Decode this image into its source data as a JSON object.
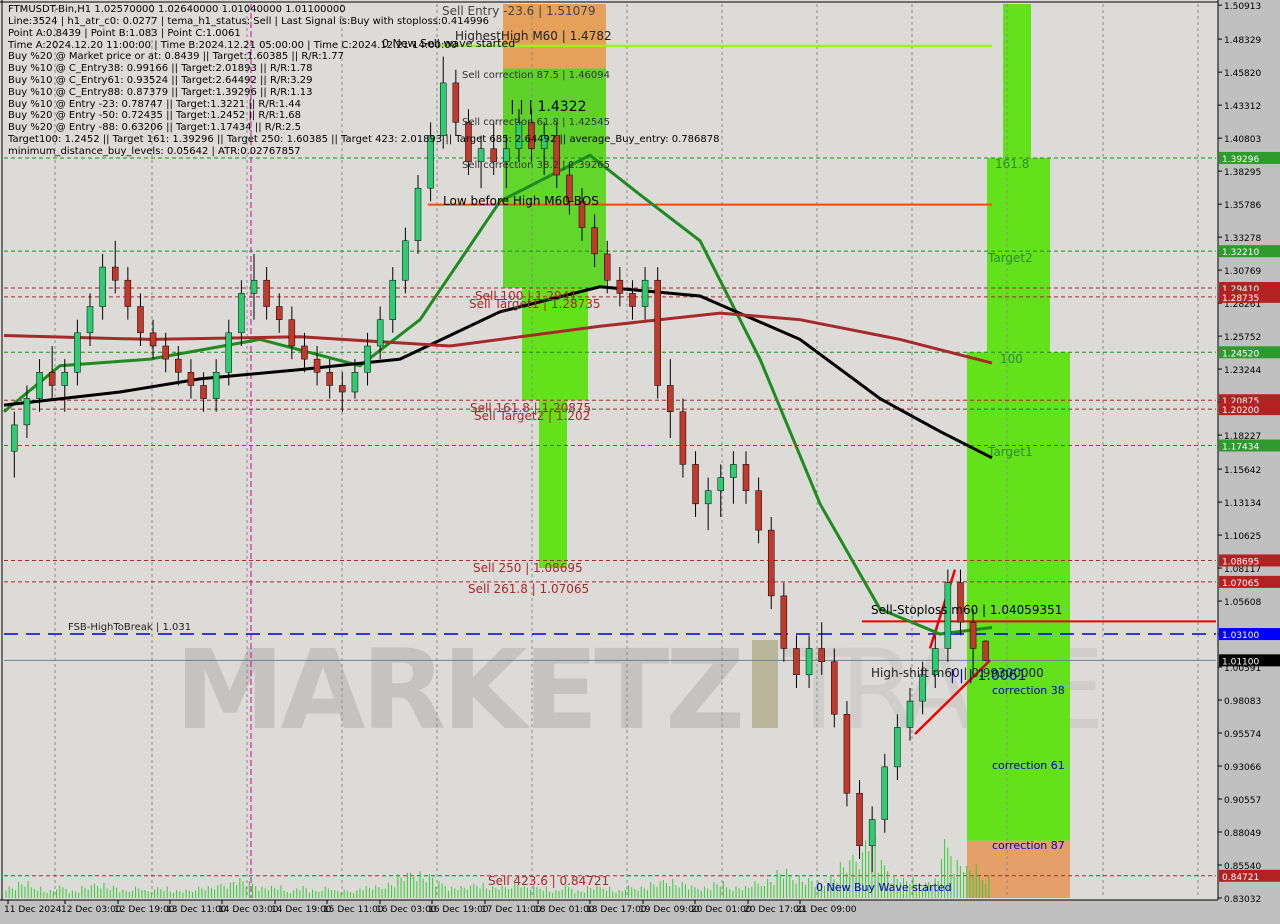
{
  "window": {
    "symbol_header": "FTMUSDT-Bin,H1  1.02570000 1.02640000 1.01040000 1.01100000"
  },
  "info_panel": [
    "Line:3524 | h1_atr_c0: 0.0277 | tema_h1_status: Sell | Last Signal is:Buy with stoploss:0.414996",
    "Point A:0.8439 | Point B:1.083 | Point C:1.0061",
    "Time A:2024.12.20 11:00:00 | Time B:2024.12.21 05:00:00 | Time C:2024.12.21 14:00:00",
    "Buy %20 @ Market price or at: 0.8439 || Target:1.60385 || R/R:1.77",
    "Buy %10 @ C_Entry38: 0.99166 || Target:2.01893 || R/R:1.78",
    "Buy %10 @ C_Entry61: 0.93524 || Target:2.64492 || R/R:3.29",
    "Buy %10 @ C_Entry88: 0.87379 || Target:1.39296 || R/R:1.13",
    "Buy %10 @ Entry -23: 0.78747 || Target:1.3221 || R/R:1.44",
    "Buy %20 @ Entry -50: 0.72435 || Target:1.2452 || R/R:1.68",
    "Buy %20 @ Entry -88: 0.63206 || Target:1.17434 || R/R:2.5",
    "Target100: 1.2452 || Target 161: 1.39296 || Target 250: 1.60385 || Target 423: 2.01893 || Target 685: 2.64492 || average_Buy_entry: 0.786878",
    "minimum_distance_buy_levels: 0.05642 | ATR:0.02767857"
  ],
  "watermark": {
    "text1": "MARKETZ",
    "text2": "I",
    "text3": "TRADE"
  },
  "chart_data": {
    "type": "candlestick",
    "title": "FTMUSDT-Bin,H1",
    "ohlc_last": {
      "open": 1.0257,
      "high": 1.0264,
      "low": 1.0104,
      "close": 1.011
    },
    "ylim": [
      0.83032,
      1.51
    ],
    "y_ticks": [
      "1.50913",
      "1.48329",
      "1.45820",
      "1.43312",
      "1.40803",
      "1.38295",
      "1.35786",
      "1.33278",
      "1.30769",
      "1.28261",
      "1.25752",
      "1.23244",
      "1.20735",
      "1.18227",
      "1.15642",
      "1.13134",
      "1.10625",
      "1.08117",
      "1.05608",
      "1.03100",
      "1.00591",
      "0.98083",
      "0.95574",
      "0.93066",
      "0.90557",
      "0.88049",
      "0.85540",
      "0.83032"
    ],
    "x_ticks": [
      "11 Dec 2024",
      "12 Dec 03:00",
      "12 Dec 19:00",
      "13 Dec 11:00",
      "14 Dec 03:00",
      "14 Dec 19:00",
      "15 Dec 11:00",
      "16 Dec 03:00",
      "16 Dec 19:00",
      "17 Dec 11:00",
      "18 Dec 01:00",
      "18 Dec 17:00",
      "19 Dec 09:00",
      "20 Dec 01:00",
      "20 Dec 17:00",
      "21 Dec 09:00"
    ],
    "price_badges": [
      {
        "value": "1.39296",
        "color": "#2e9b2e"
      },
      {
        "value": "1.32210",
        "color": "#2e9b2e"
      },
      {
        "value": "1.29410",
        "color": "#b22222"
      },
      {
        "value": "1.28735",
        "color": "#b22222"
      },
      {
        "value": "1.24520",
        "color": "#2e9b2e"
      },
      {
        "value": "1.20875",
        "color": "#b22222"
      },
      {
        "value": "1.20200",
        "color": "#b22222"
      },
      {
        "value": "1.17434",
        "color": "#2e9b2e"
      },
      {
        "value": "1.08695",
        "color": "#b22222"
      },
      {
        "value": "1.07065",
        "color": "#b22222"
      },
      {
        "value": "1.03100",
        "color": "#0000ff"
      },
      {
        "value": "1.01100",
        "color": "#000000"
      },
      {
        "value": "0.84721",
        "color": "#b22222"
      }
    ],
    "sell_levels": [
      {
        "label": "Sell Entry -23.6 | 1.51079",
        "value": 1.51079
      },
      {
        "label": "HighestHigh   M60 | 1.4782",
        "value": 1.4782
      },
      {
        "label": "Sell correction 87.5 | 1.46094",
        "value": 1.46094
      },
      {
        "label": "| | | 1.4322",
        "value": 1.4322
      },
      {
        "label": "Sell correction 61.8 | 1.42545",
        "value": 1.42545
      },
      {
        "label": "Sell correction 38.2 | 1.39265",
        "value": 1.39265
      },
      {
        "label": "Low before High   M60-BOS",
        "value": 1.3575
      },
      {
        "label": "Sell 100 | 1.2941",
        "value": 1.2941
      },
      {
        "label": "Sell Target1 | 1.28735",
        "value": 1.28735
      },
      {
        "label": "Sell 161.8 | 1.20875",
        "value": 1.20875
      },
      {
        "label": "Sell Target2 | 1.202",
        "value": 1.202
      },
      {
        "label": "Sell 250 | 1.08695",
        "value": 1.08695
      },
      {
        "label": "Sell 261.8 | 1.07065",
        "value": 1.07065
      },
      {
        "label": "Sell 423.6 | 0.84721",
        "value": 0.84721
      }
    ],
    "buy_levels": [
      {
        "label": "161.8",
        "value": 1.39296
      },
      {
        "label": "Target2",
        "value": 1.3221
      },
      {
        "label": "100",
        "value": 1.2452
      },
      {
        "label": "Target1",
        "value": 1.17434
      },
      {
        "label": "correction 38",
        "value": 0.99166
      },
      {
        "label": "correction 61",
        "value": 0.93524
      },
      {
        "label": "correction 87",
        "value": 0.87379
      }
    ],
    "annotations": {
      "new_sell_wave": "0 New Sell wave started",
      "new_buy_wave": "0 New Buy Wave started",
      "fsb_high": "FSB-HighToBreak | 1.031",
      "sell_stoploss": "Sell-Stoploss m60 | 1.04059351",
      "high_shift": "High-shift m60 | 0.99300000",
      "point_c_label": "| | | 1.0061"
    },
    "moving_averages": [
      {
        "name": "green",
        "color": "#1e8c1e"
      },
      {
        "name": "black",
        "color": "#000000"
      },
      {
        "name": "brown",
        "color": "#a52a2a"
      }
    ],
    "candles": [
      [
        1.17,
        1.2,
        1.15,
        1.19
      ],
      [
        1.19,
        1.22,
        1.18,
        1.21
      ],
      [
        1.21,
        1.24,
        1.2,
        1.23
      ],
      [
        1.23,
        1.25,
        1.21,
        1.22
      ],
      [
        1.22,
        1.24,
        1.2,
        1.23
      ],
      [
        1.23,
        1.27,
        1.22,
        1.26
      ],
      [
        1.26,
        1.29,
        1.25,
        1.28
      ],
      [
        1.28,
        1.32,
        1.27,
        1.31
      ],
      [
        1.31,
        1.33,
        1.29,
        1.3
      ],
      [
        1.3,
        1.31,
        1.27,
        1.28
      ],
      [
        1.28,
        1.29,
        1.25,
        1.26
      ],
      [
        1.26,
        1.27,
        1.24,
        1.25
      ],
      [
        1.25,
        1.26,
        1.23,
        1.24
      ],
      [
        1.24,
        1.25,
        1.22,
        1.23
      ],
      [
        1.23,
        1.24,
        1.21,
        1.22
      ],
      [
        1.22,
        1.23,
        1.2,
        1.21
      ],
      [
        1.21,
        1.24,
        1.2,
        1.23
      ],
      [
        1.23,
        1.27,
        1.22,
        1.26
      ],
      [
        1.26,
        1.3,
        1.25,
        1.29
      ],
      [
        1.29,
        1.32,
        1.27,
        1.3
      ],
      [
        1.3,
        1.31,
        1.27,
        1.28
      ],
      [
        1.28,
        1.29,
        1.26,
        1.27
      ],
      [
        1.27,
        1.28,
        1.24,
        1.25
      ],
      [
        1.25,
        1.26,
        1.23,
        1.24
      ],
      [
        1.24,
        1.25,
        1.22,
        1.23
      ],
      [
        1.23,
        1.24,
        1.21,
        1.22
      ],
      [
        1.22,
        1.23,
        1.2,
        1.215
      ],
      [
        1.215,
        1.24,
        1.21,
        1.23
      ],
      [
        1.23,
        1.26,
        1.22,
        1.25
      ],
      [
        1.25,
        1.28,
        1.24,
        1.27
      ],
      [
        1.27,
        1.31,
        1.26,
        1.3
      ],
      [
        1.3,
        1.34,
        1.29,
        1.33
      ],
      [
        1.33,
        1.38,
        1.32,
        1.37
      ],
      [
        1.37,
        1.42,
        1.36,
        1.41
      ],
      [
        1.41,
        1.47,
        1.4,
        1.45
      ],
      [
        1.45,
        1.46,
        1.41,
        1.42
      ],
      [
        1.42,
        1.43,
        1.38,
        1.39
      ],
      [
        1.39,
        1.41,
        1.37,
        1.4
      ],
      [
        1.4,
        1.42,
        1.38,
        1.39
      ],
      [
        1.39,
        1.41,
        1.37,
        1.4
      ],
      [
        1.4,
        1.43,
        1.39,
        1.42
      ],
      [
        1.42,
        1.43,
        1.39,
        1.4
      ],
      [
        1.4,
        1.42,
        1.38,
        1.41
      ],
      [
        1.41,
        1.42,
        1.37,
        1.38
      ],
      [
        1.38,
        1.39,
        1.35,
        1.36
      ],
      [
        1.36,
        1.37,
        1.33,
        1.34
      ],
      [
        1.34,
        1.35,
        1.31,
        1.32
      ],
      [
        1.32,
        1.33,
        1.29,
        1.3
      ],
      [
        1.3,
        1.31,
        1.28,
        1.29
      ],
      [
        1.29,
        1.3,
        1.27,
        1.28
      ],
      [
        1.28,
        1.31,
        1.27,
        1.3
      ],
      [
        1.3,
        1.31,
        1.21,
        1.22
      ],
      [
        1.22,
        1.24,
        1.18,
        1.2
      ],
      [
        1.2,
        1.21,
        1.15,
        1.16
      ],
      [
        1.16,
        1.17,
        1.12,
        1.13
      ],
      [
        1.13,
        1.15,
        1.11,
        1.14
      ],
      [
        1.14,
        1.16,
        1.12,
        1.15
      ],
      [
        1.15,
        1.17,
        1.13,
        1.16
      ],
      [
        1.16,
        1.17,
        1.13,
        1.14
      ],
      [
        1.14,
        1.15,
        1.1,
        1.11
      ],
      [
        1.11,
        1.12,
        1.05,
        1.06
      ],
      [
        1.06,
        1.07,
        1.01,
        1.02
      ],
      [
        1.02,
        1.03,
        0.99,
        1.0
      ],
      [
        1.0,
        1.03,
        0.99,
        1.02
      ],
      [
        1.02,
        1.04,
        1.0,
        1.01
      ],
      [
        1.01,
        1.02,
        0.96,
        0.97
      ],
      [
        0.97,
        0.98,
        0.9,
        0.91
      ],
      [
        0.91,
        0.92,
        0.86,
        0.87
      ],
      [
        0.87,
        0.9,
        0.85,
        0.89
      ],
      [
        0.89,
        0.94,
        0.88,
        0.93
      ],
      [
        0.93,
        0.97,
        0.92,
        0.96
      ],
      [
        0.96,
        0.99,
        0.95,
        0.98
      ],
      [
        0.98,
        1.01,
        0.97,
        1.0
      ],
      [
        1.0,
        1.03,
        0.99,
        1.02
      ],
      [
        1.02,
        1.08,
        1.01,
        1.07
      ],
      [
        1.07,
        1.08,
        1.03,
        1.04
      ],
      [
        1.04,
        1.05,
        1.0,
        1.02
      ],
      [
        1.0257,
        1.0264,
        1.0104,
        1.011
      ]
    ],
    "volume": [
      3,
      4,
      3,
      2,
      3,
      2,
      3,
      4,
      3,
      2,
      3,
      2,
      3,
      2,
      2,
      3,
      3,
      4,
      5,
      4,
      3,
      3,
      2,
      3,
      2,
      3,
      2,
      2,
      3,
      3,
      4,
      6,
      7,
      6,
      4,
      3,
      3,
      4,
      3,
      3,
      4,
      3,
      3,
      2,
      3,
      2,
      3,
      3,
      2,
      3,
      3,
      4,
      5,
      4,
      3,
      3,
      4,
      3,
      3,
      4,
      5,
      7,
      6,
      5,
      4,
      6,
      9,
      12,
      18,
      9,
      6,
      5,
      4,
      5,
      14,
      10,
      8,
      6
    ]
  }
}
